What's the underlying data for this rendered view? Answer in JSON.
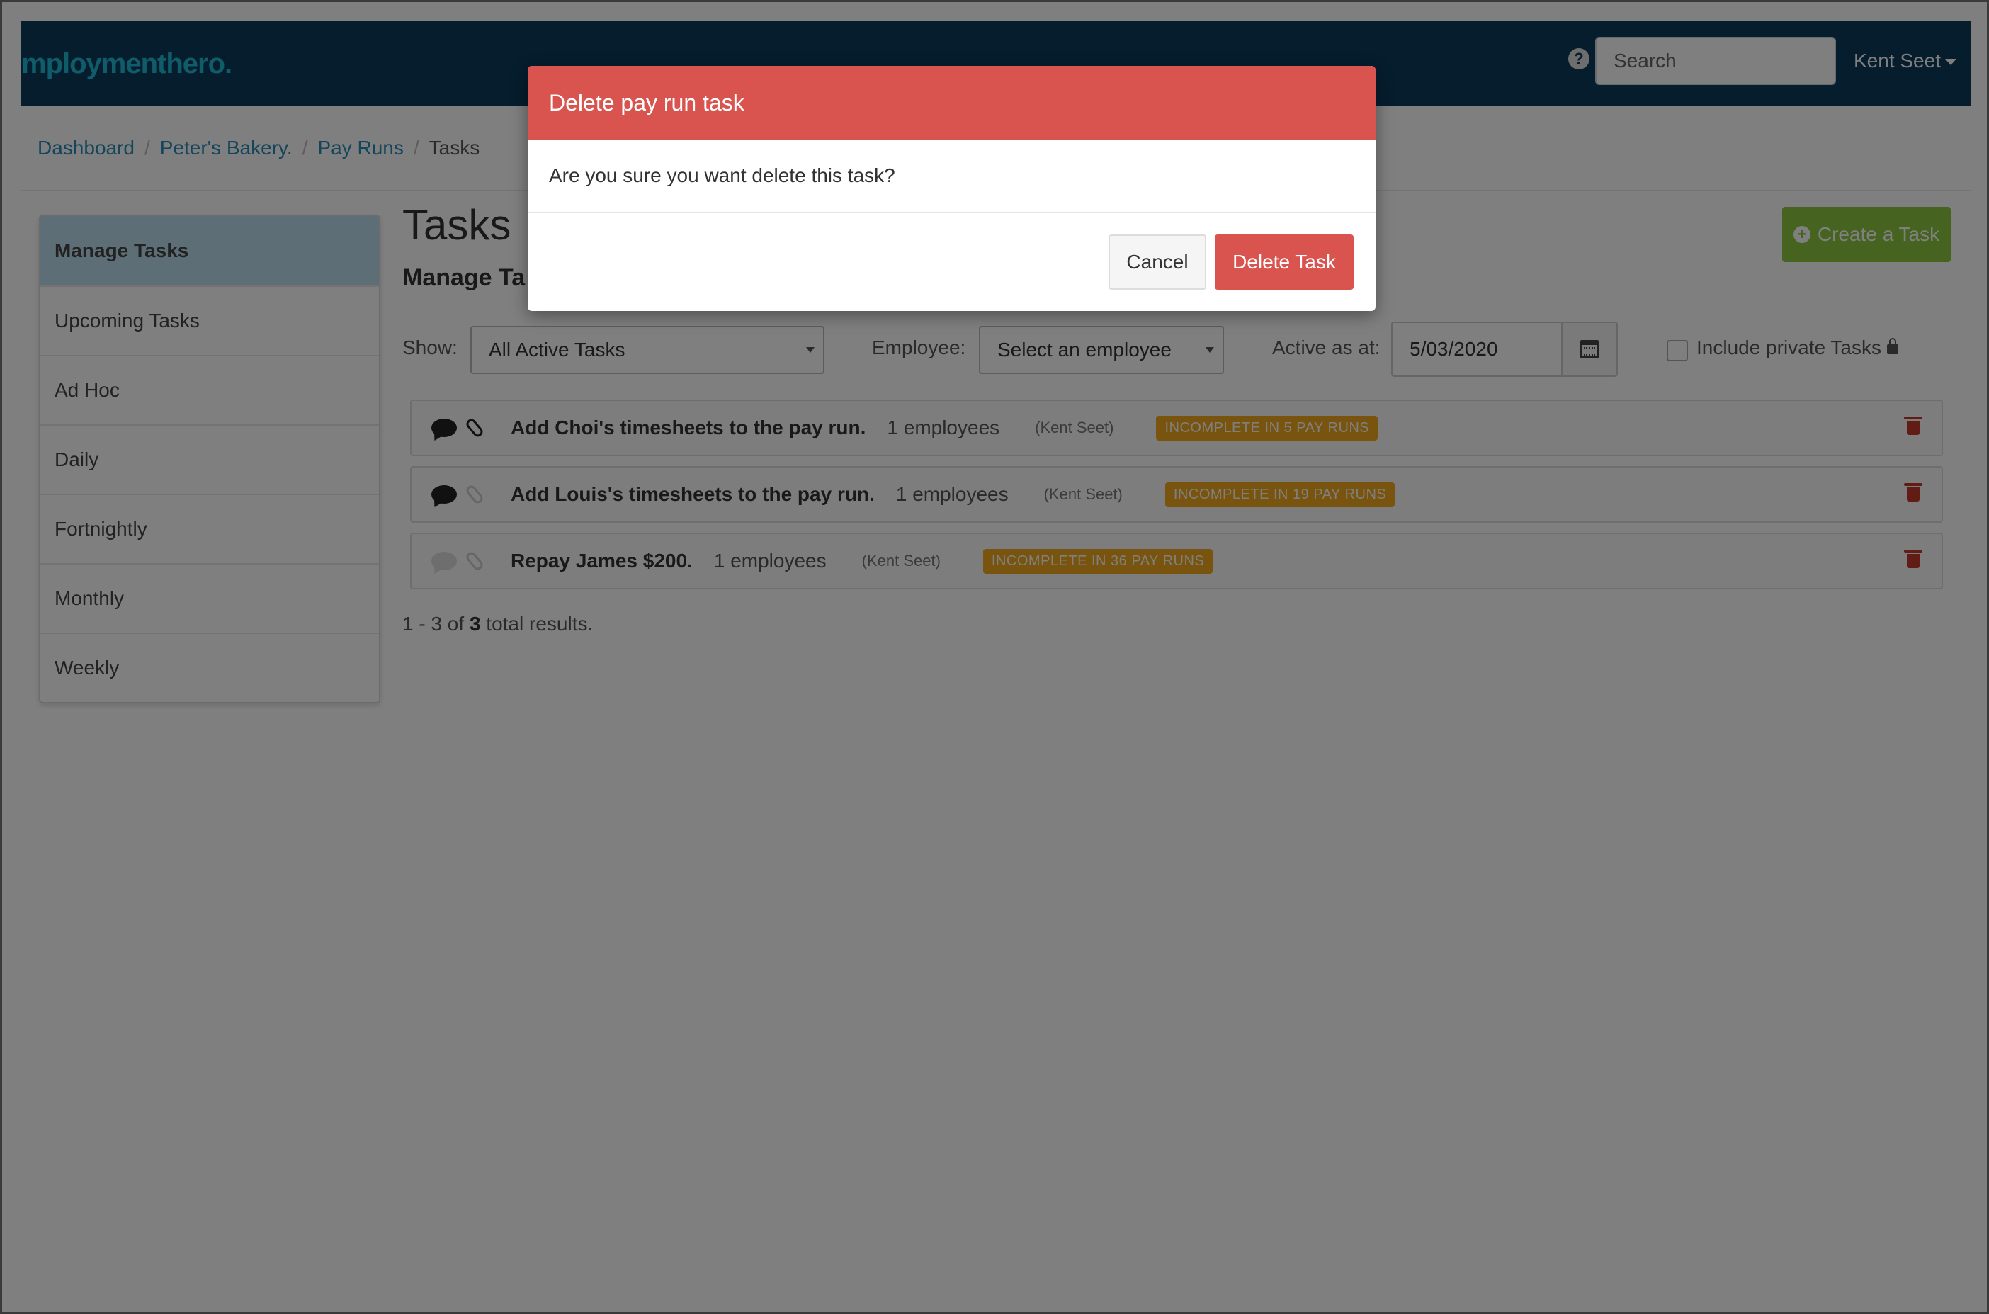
{
  "nav": {
    "brand": "mploymenthero.",
    "help": "?",
    "search_placeholder": "Search",
    "user": "Kent Seet"
  },
  "breadcrumb": [
    "Dashboard",
    "Peter's Bakery.",
    "Pay Runs",
    "Tasks"
  ],
  "sidebar": {
    "items": [
      {
        "label": "Manage Tasks"
      },
      {
        "label": "Upcoming Tasks"
      },
      {
        "label": "Ad Hoc"
      },
      {
        "label": "Daily"
      },
      {
        "label": "Fortnightly"
      },
      {
        "label": "Monthly"
      },
      {
        "label": "Weekly"
      }
    ]
  },
  "main": {
    "title": "Tasks",
    "subtitle": "Manage Ta",
    "create_label": "Create a Task",
    "filters": {
      "show_label": "Show:",
      "show_value": "All Active Tasks",
      "employee_label": "Employee:",
      "employee_value": "Select an employee",
      "active_label": "Active as at:",
      "active_value": "5/03/2020",
      "private_label": "Include private Tasks"
    },
    "tasks": [
      {
        "title": "Add Choi's timesheets to the pay run.",
        "employees": "1 employees",
        "owner": "(Kent Seet)",
        "badge": "INCOMPLETE IN 5 PAY RUNS"
      },
      {
        "title": "Add Louis's timesheets to the pay run.",
        "employees": "1 employees",
        "owner": "(Kent Seet)",
        "badge": "INCOMPLETE IN 19 PAY RUNS"
      },
      {
        "title": "Repay James $200.",
        "employees": "1 employees",
        "owner": "(Kent Seet)",
        "badge": "INCOMPLETE IN 36 PAY RUNS"
      }
    ],
    "results": {
      "prefix": "1 - 3 of ",
      "total": "3",
      "suffix": " total results."
    }
  },
  "modal": {
    "title": "Delete pay run task",
    "message": "Are you sure you want delete this task?",
    "cancel_label": "Cancel",
    "delete_label": "Delete Task"
  }
}
